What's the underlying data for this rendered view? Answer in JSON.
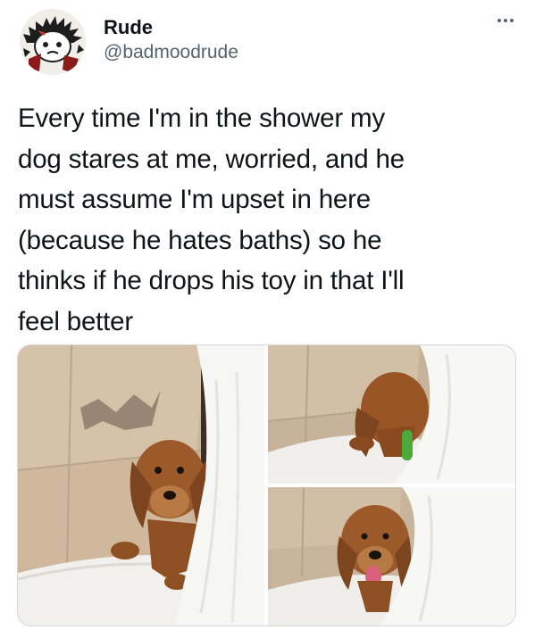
{
  "author": {
    "display_name": "Rude",
    "handle": "@badmoodrude"
  },
  "tweet": {
    "text_lines": [
      "Every time I'm in the shower my",
      "dog stares at me, worried, and he",
      "must assume I'm upset in here",
      "(because he hates baths) so he",
      "thinks if he drops his toy in that I'll",
      "feel better"
    ]
  },
  "icons": {
    "more": "more-horizontal-icon"
  },
  "colors": {
    "text": "#0f1419",
    "secondary": "#536471",
    "border": "#cfd9de"
  }
}
